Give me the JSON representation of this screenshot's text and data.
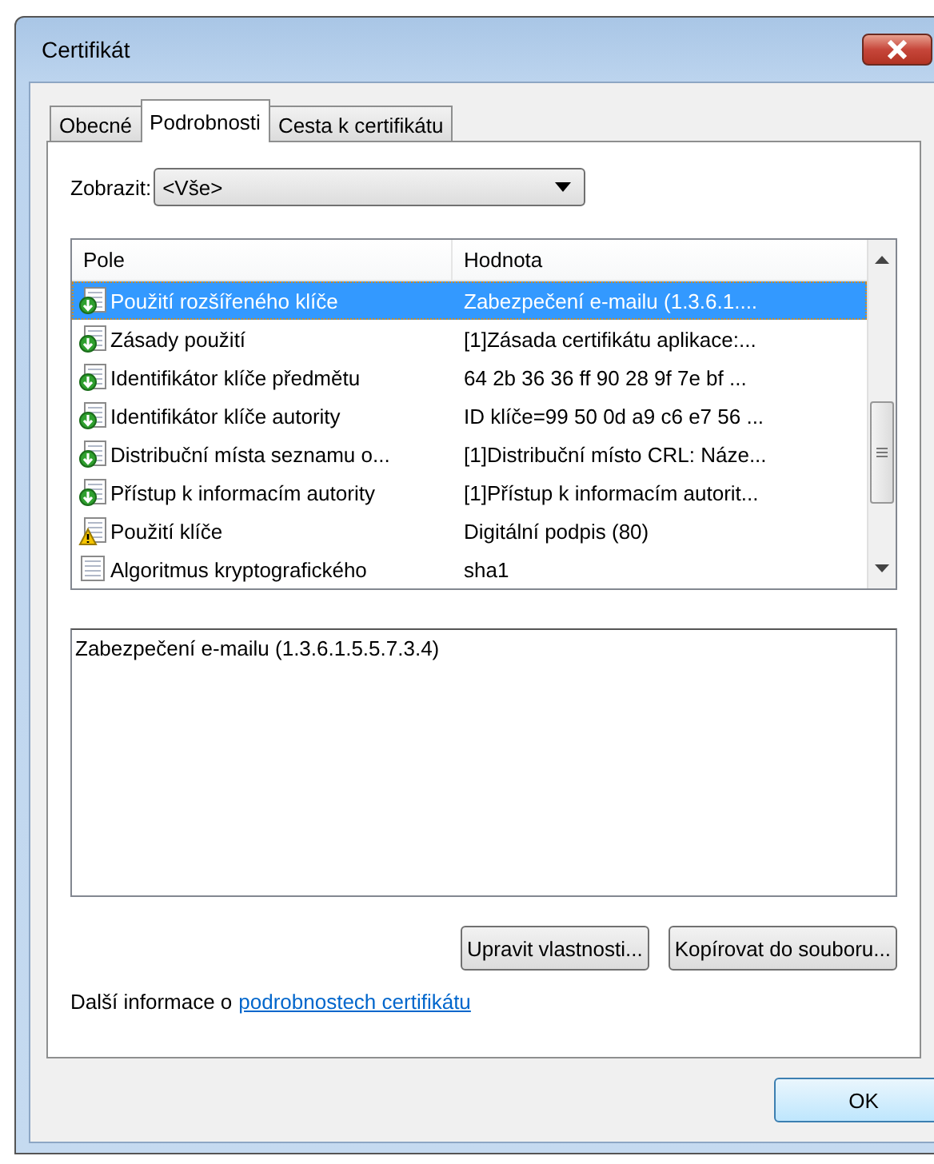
{
  "window": {
    "title": "Certifikát"
  },
  "tabs": [
    {
      "label": "Obecné",
      "selected": false
    },
    {
      "label": "Podrobnosti",
      "selected": true
    },
    {
      "label": "Cesta k certifikátu",
      "selected": false
    }
  ],
  "show": {
    "label": "Zobrazit:",
    "value": "<Vše>"
  },
  "table": {
    "columns": [
      "Pole",
      "Hodnota"
    ],
    "rows": [
      {
        "kind": "extension",
        "field": "Použití rozšířeného klíče",
        "value": "Zabezpečení e-mailu (1.3.6.1....",
        "selected": true
      },
      {
        "kind": "extension",
        "field": "Zásady použití",
        "value": "[1]Zásada certifikátu aplikace:...",
        "selected": false
      },
      {
        "kind": "extension",
        "field": "Identifikátor klíče předmětu",
        "value": "64 2b 36 36 ff 90 28 9f 7e bf ...",
        "selected": false
      },
      {
        "kind": "extension",
        "field": "Identifikátor klíče autority",
        "value": "ID klíče=99 50 0d a9 c6 e7 56 ...",
        "selected": false
      },
      {
        "kind": "extension",
        "field": "Distribuční místa seznamu o...",
        "value": "[1]Distribuční místo CRL: Náze...",
        "selected": false
      },
      {
        "kind": "extension",
        "field": "Přístup k informacím autority",
        "value": "[1]Přístup k informacím autorit...",
        "selected": false
      },
      {
        "kind": "critical",
        "field": "Použití klíče",
        "value": "Digitální podpis (80)",
        "selected": false
      },
      {
        "kind": "plain",
        "field": "Algoritmus kryptografického",
        "value": "sha1",
        "selected": false
      }
    ]
  },
  "detail": {
    "value": "Zabezpečení e-mailu (1.3.6.1.5.5.7.3.4)"
  },
  "buttons": [
    "Upravit vlastnosti...",
    "Kopírovat do souboru..."
  ],
  "info": {
    "text": "Další informace o",
    "link": "podrobnostech certifikátu"
  },
  "footer_buttons": [
    "OK"
  ]
}
